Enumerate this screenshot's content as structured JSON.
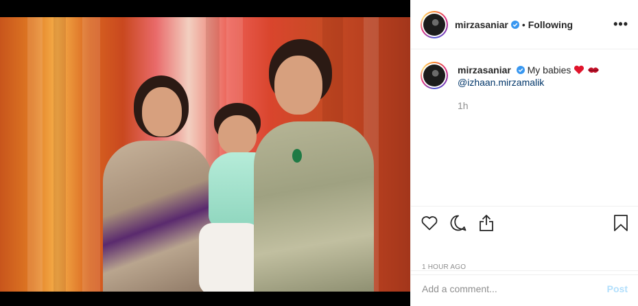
{
  "header": {
    "username": "mirzasaniar",
    "separator": "•",
    "follow_status": "Following",
    "more_label": "•••"
  },
  "caption": {
    "username": "mirzasaniar",
    "text": "My babies",
    "mention": "@izhaan.mirzamalik",
    "time_ago": "1h"
  },
  "actions": {
    "like_icon": "heart-outline-icon",
    "comment_icon": "comment-bubble-icon",
    "share_icon": "share-icon",
    "save_icon": "bookmark-icon"
  },
  "post_meta": {
    "timestamp": "1 HOUR AGO"
  },
  "comment_box": {
    "placeholder": "Add a comment...",
    "post_label": "Post"
  },
  "colors": {
    "verified": "#3897f0",
    "post_disabled": "#b2dffc",
    "link": "#003569",
    "muted": "#8e8e8e"
  }
}
